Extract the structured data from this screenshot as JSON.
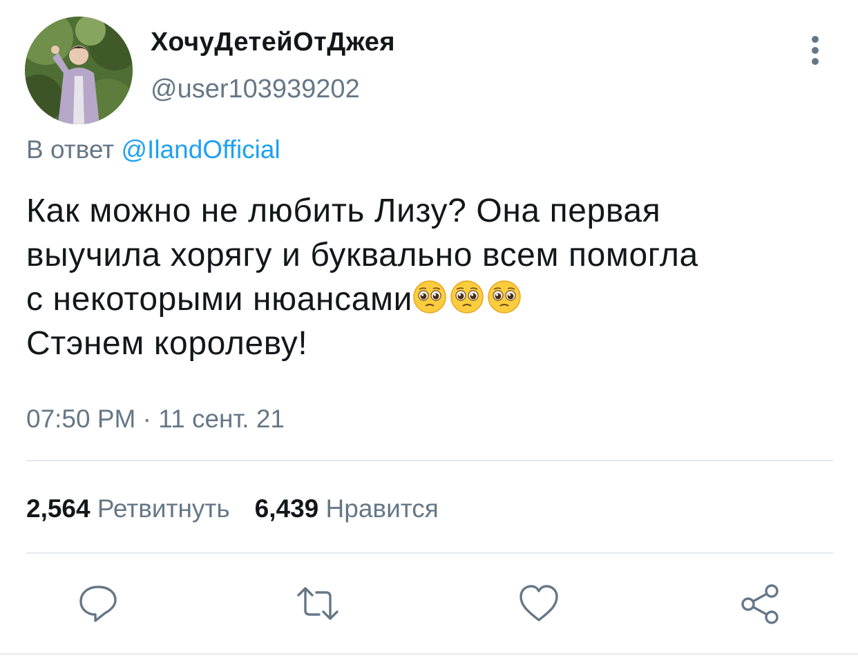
{
  "author": {
    "display_name": "ХочуДетейОтДжея",
    "username": "@user103939202",
    "avatar_icon": "user-avatar-photo"
  },
  "reply": {
    "prefix": "В ответ",
    "mention": "@IlandOfficial"
  },
  "tweet": {
    "lines": [
      "Как можно не любить Лизу? Она первая",
      "выучила хорягу и буквально  всем помогла",
      "с некоторыми нюансами",
      "Стэнем королеву!"
    ],
    "emojis": [
      "pleading-face",
      "pleading-face",
      "pleading-face"
    ],
    "timestamp": "07:50 PM · 11 сент. 21"
  },
  "stats": {
    "retweets_count": "2,564",
    "retweets_label": "Ретвитнуть",
    "likes_count": "6,439",
    "likes_label": "Нравится"
  },
  "actions": [
    {
      "name": "reply",
      "icon": "reply-icon"
    },
    {
      "name": "retweet",
      "icon": "retweet-icon"
    },
    {
      "name": "like",
      "icon": "heart-icon"
    },
    {
      "name": "share",
      "icon": "share-icon"
    }
  ],
  "colors": {
    "text": "#14171a",
    "secondary": "#657786",
    "link": "#1da1f2",
    "divider": "#e1e8ed"
  }
}
